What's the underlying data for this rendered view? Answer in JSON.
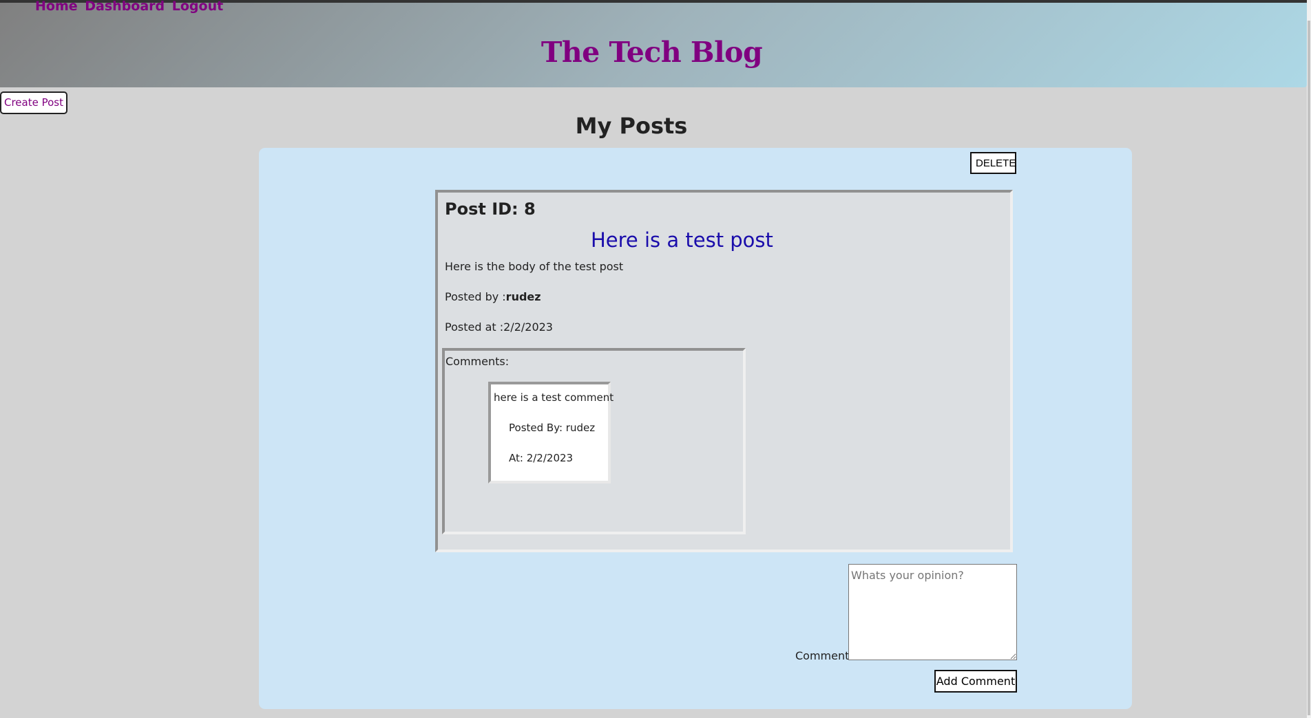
{
  "nav": {
    "home": "Home",
    "dashboard": "Dashboard",
    "logout": "Logout"
  },
  "site_title": "The Tech Blog",
  "create_post_label": "Create Post",
  "page_heading": "My Posts",
  "delete_label": "DELETE",
  "post": {
    "id_label": "Post ID: 8",
    "title": "Here is a test post",
    "body": "Here is the body of the test post",
    "posted_by_prefix": "Posted by :",
    "author": "rudez",
    "posted_at": "Posted at :2/2/2023"
  },
  "comments": {
    "label": "Comments:",
    "items": [
      {
        "text": "here is a test comment",
        "posted_by": "Posted By: rudez",
        "at": "At: 2/2/2023"
      }
    ]
  },
  "comment_form": {
    "label": "Comment:",
    "placeholder": "Whats your opinion?",
    "value": "",
    "submit_label": "Add Comment"
  },
  "colors": {
    "accent": "#800080",
    "post_title": "#1a0dab",
    "panel_bg": "#cde5f6",
    "page_bg": "#d3d3d3"
  }
}
